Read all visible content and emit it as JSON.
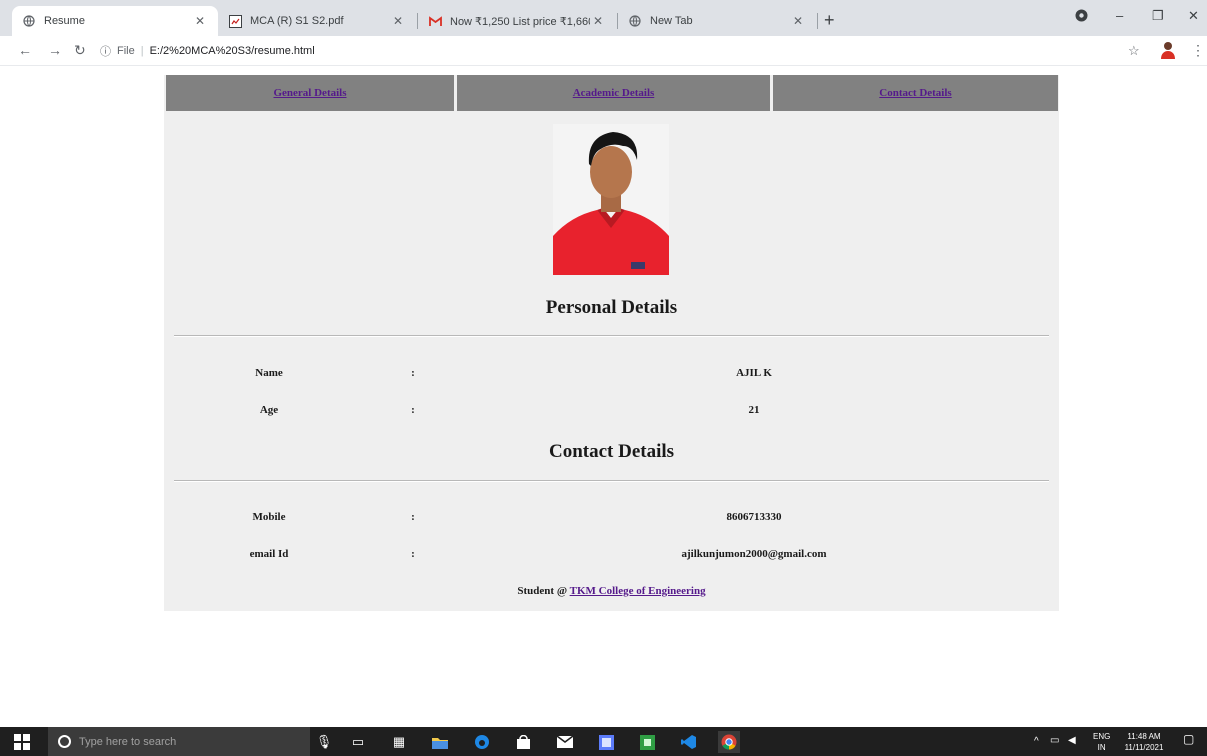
{
  "browser": {
    "tabs": [
      {
        "title": "Resume",
        "icon": "globe-icon",
        "active": true
      },
      {
        "title": "MCA (R) S1 S2.pdf",
        "icon": "pdf-icon",
        "active": false
      },
      {
        "title": "Now ₹1,250 List price ₹1,660 a...",
        "icon": "gmail-icon",
        "active": false
      },
      {
        "title": "New Tab",
        "icon": "globe-icon",
        "active": false
      }
    ],
    "address": {
      "scheme_label": "File",
      "url": "E:/2%20MCA%20S3/resume.html"
    }
  },
  "resume": {
    "nav": [
      "General Details",
      "Academic Details",
      "Contact Details"
    ],
    "personal_heading": "Personal Details",
    "personal_rows": [
      {
        "label": "Name",
        "colon": ":",
        "value": "AJIL K"
      },
      {
        "label": "Age",
        "colon": ":",
        "value": "21"
      }
    ],
    "contact_heading": "Contact Details",
    "contact_rows": [
      {
        "label": "Mobile",
        "colon": ":",
        "value": "8606713330"
      },
      {
        "label": "email Id",
        "colon": ":",
        "value": "ajilkunjumon2000@gmail.com"
      }
    ],
    "footer_prefix": "Student @",
    "footer_link": "TKM College of Engineering"
  },
  "taskbar": {
    "search_placeholder": "Type here to search",
    "lang_top": "ENG",
    "lang_bottom": "IN",
    "time": "11:48 AM",
    "date": "11/11/2021"
  }
}
